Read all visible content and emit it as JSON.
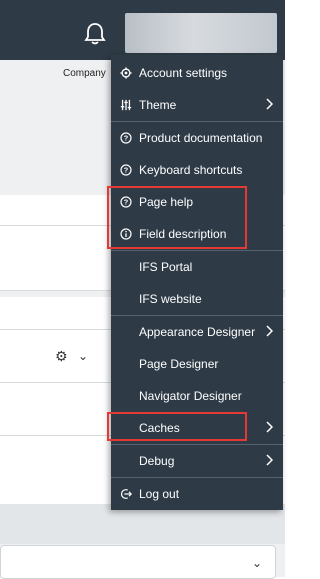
{
  "header": {
    "user": ""
  },
  "background": {
    "company_label": "Company"
  },
  "menu": {
    "items": [
      {
        "label": "Account settings",
        "icon": "gear-icon"
      },
      {
        "label": "Theme",
        "icon": "sliders-icon",
        "submenu": true
      },
      {
        "label": "Product documentation",
        "icon": "help-circle-icon"
      },
      {
        "label": "Keyboard shortcuts",
        "icon": "help-circle-icon"
      },
      {
        "label": "Page help",
        "icon": "help-circle-icon"
      },
      {
        "label": "Field description",
        "icon": "info-circle-icon"
      },
      {
        "label": "IFS Portal"
      },
      {
        "label": "IFS website"
      },
      {
        "label": "Appearance Designer",
        "submenu": true
      },
      {
        "label": "Page Designer"
      },
      {
        "label": "Navigator Designer"
      },
      {
        "label": "Caches",
        "submenu": true
      },
      {
        "label": "Debug",
        "submenu": true
      },
      {
        "label": "Log out",
        "icon": "logout-icon"
      }
    ]
  },
  "colors": {
    "menu_bg": "#2e3a46",
    "highlight": "#e53935"
  }
}
